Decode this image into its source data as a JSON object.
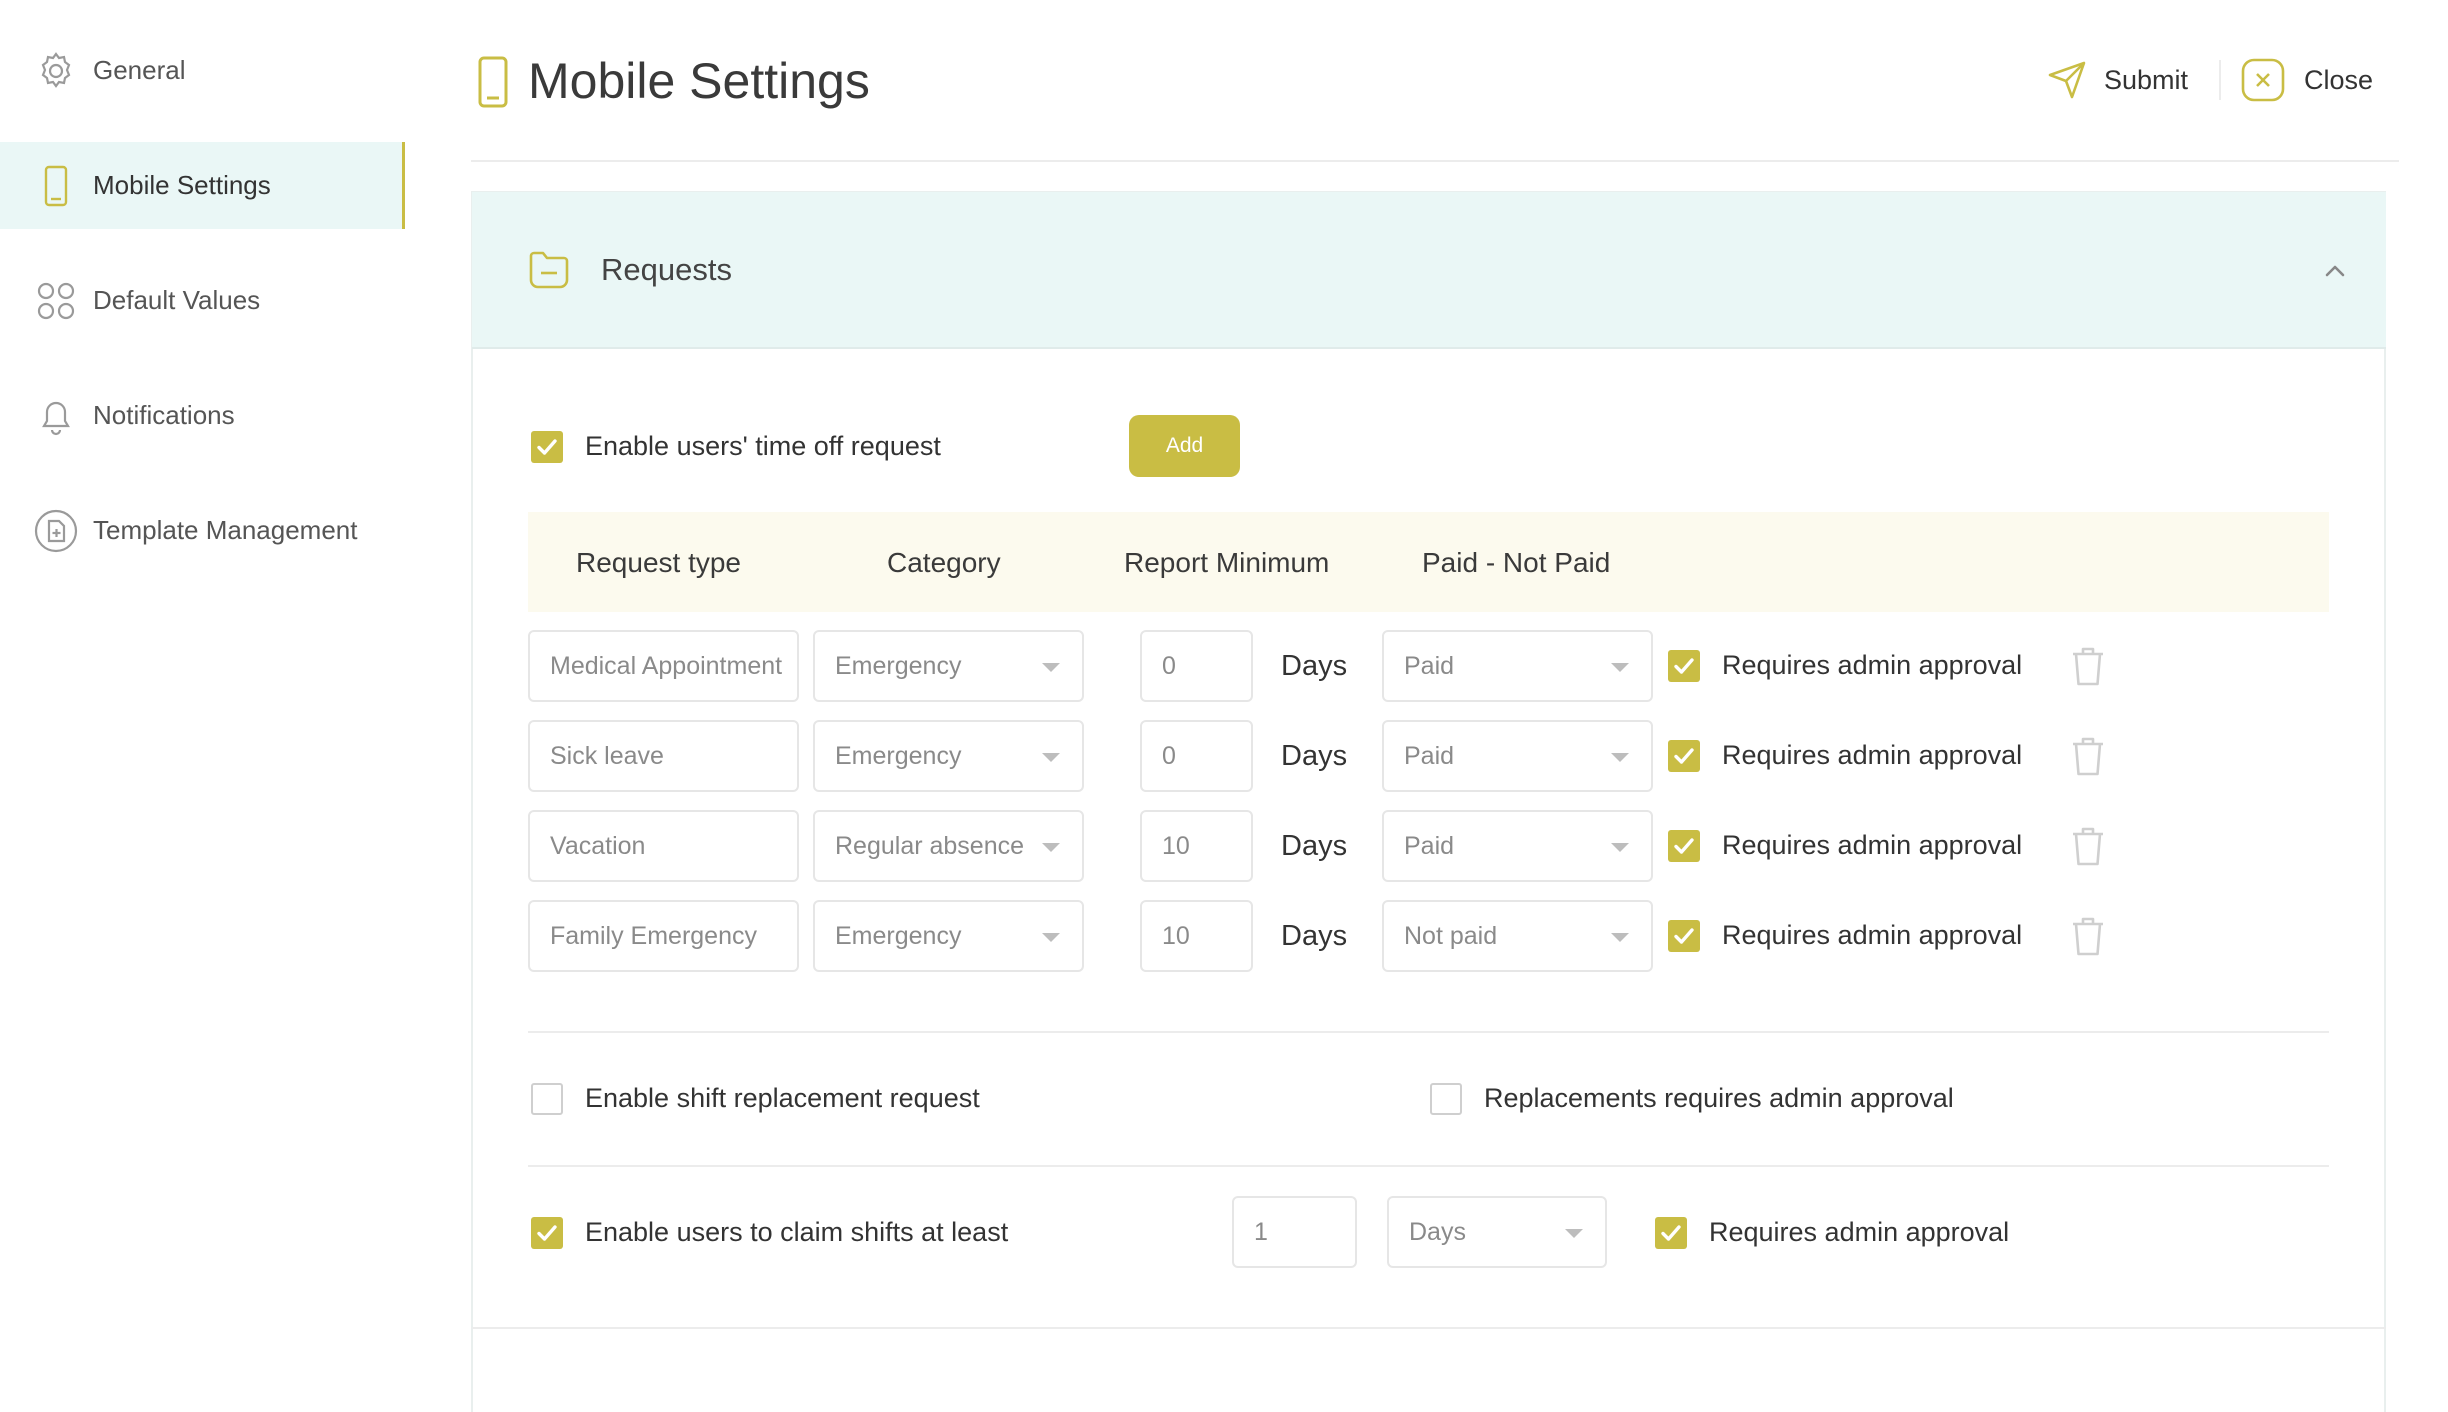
{
  "sidebar": {
    "items": [
      {
        "label": "General",
        "icon": "gear-icon"
      },
      {
        "label": "Mobile Settings",
        "icon": "mobile-icon",
        "active": true
      },
      {
        "label": "Default Values",
        "icon": "grid-icon"
      },
      {
        "label": "Notifications",
        "icon": "bell-icon"
      },
      {
        "label": "Template Management",
        "icon": "document-icon"
      }
    ]
  },
  "header": {
    "title": "Mobile Settings",
    "submit_label": "Submit",
    "close_label": "Close"
  },
  "section": {
    "title": "Requests",
    "time_off": {
      "label": "Enable users' time off request",
      "checked": true,
      "add_label": "Add"
    },
    "columns": [
      "Request type",
      "Category",
      "Report Minimum",
      "Paid - Not Paid"
    ],
    "rows": [
      {
        "type": "Medical Appointment",
        "category": "Emergency",
        "minimum": "0",
        "unit": "Days",
        "paid": "Paid",
        "approval_label": "Requires admin approval",
        "approval": true
      },
      {
        "type": "Sick leave",
        "category": "Emergency",
        "minimum": "0",
        "unit": "Days",
        "paid": "Paid",
        "approval_label": "Requires admin approval",
        "approval": true
      },
      {
        "type": "Vacation",
        "category": "Regular absence",
        "minimum": "10",
        "unit": "Days",
        "paid": "Paid",
        "approval_label": "Requires admin approval",
        "approval": true
      },
      {
        "type": "Family Emergency",
        "category": "Emergency",
        "minimum": "10",
        "unit": "Days",
        "paid": "Not paid",
        "approval_label": "Requires admin approval",
        "approval": true
      }
    ],
    "shift_replacement": {
      "label": "Enable shift replacement request",
      "checked": false,
      "approval_label": "Replacements requires admin approval",
      "approval": false
    },
    "claim_shifts": {
      "label": "Enable users to claim shifts at least",
      "checked": true,
      "value": "1",
      "unit": "Days",
      "approval_label": "Requires admin approval",
      "approval": true
    }
  },
  "colors": {
    "accent": "#c9bd44",
    "active_bg": "#eaf7f6",
    "table_head_bg": "#fcfaee"
  }
}
